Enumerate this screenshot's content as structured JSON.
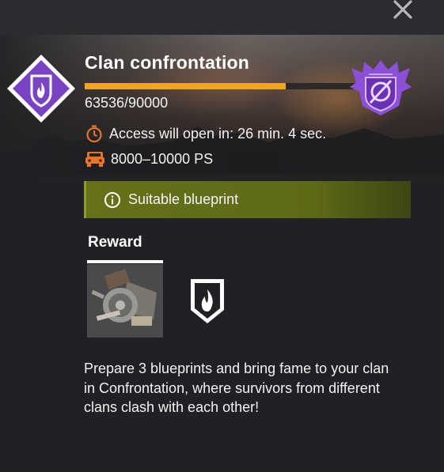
{
  "window": {
    "close_icon": "close-icon"
  },
  "event": {
    "title": "Clan confrontation",
    "progress_text": "63536/90000",
    "progress_fraction": 0.706,
    "access_text": "Access will open in: 26 min. 4 sec.",
    "power_text": "8000–10000 PS",
    "badge_icon": "flame-shield-icon",
    "emblem_icon": "clan-emblem-icon"
  },
  "suitable": {
    "label": "Suitable blueprint",
    "icon": "info-icon"
  },
  "reward": {
    "label": "Reward",
    "items": [
      "scrap-parts-icon",
      "flame-shield-icon"
    ]
  },
  "description": "Prepare 3 blueprints and bring fame to your clan in Confrontation, where survivors from different clans clash with each other!",
  "colors": {
    "progress": "#f2a31f",
    "suitable_bg": "#667119",
    "accent_purple": "#7a43c6",
    "orange_icons": "#e8742a"
  }
}
